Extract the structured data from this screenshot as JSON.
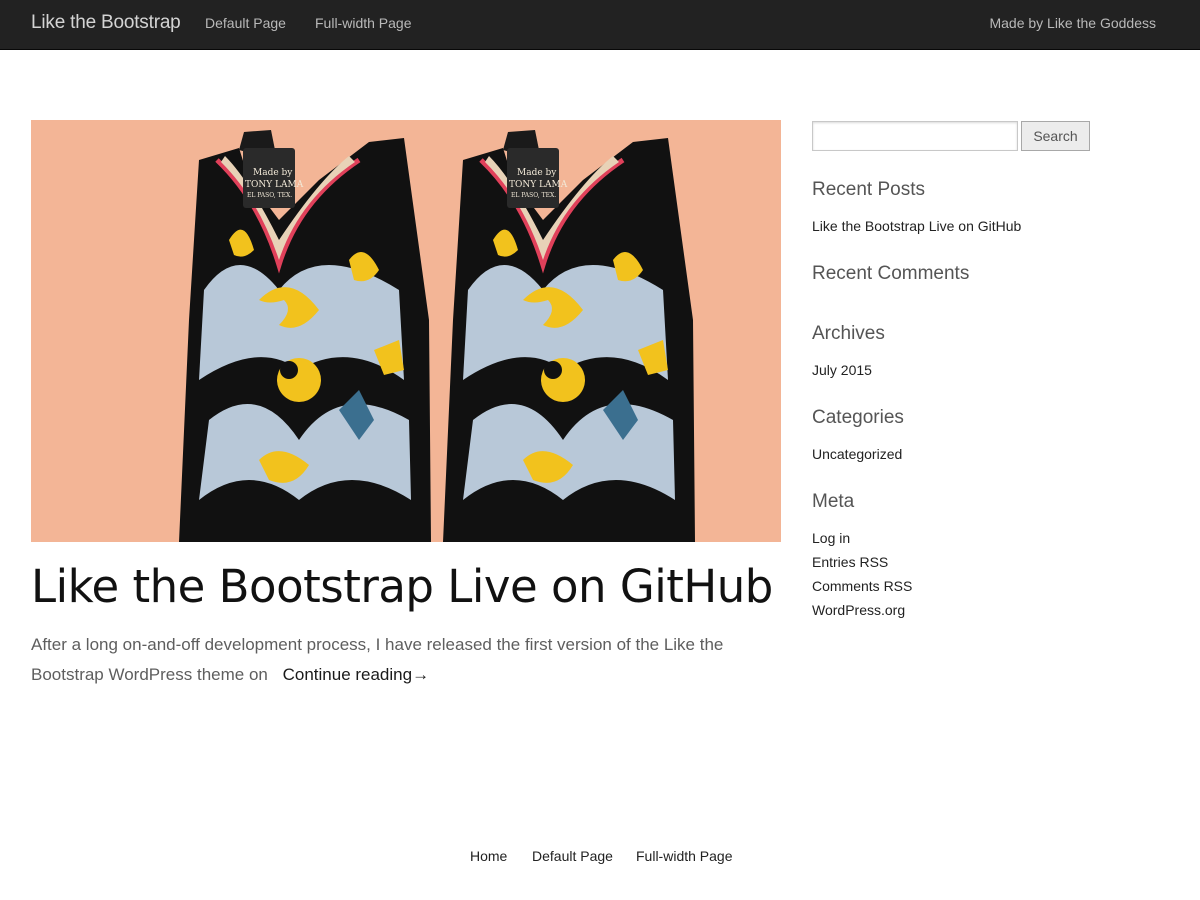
{
  "navbar": {
    "brand": "Like the Bootstrap",
    "links": [
      "Default Page",
      "Full-width Page"
    ],
    "right_link": "Made by Like the Goddess",
    "background": "#222222"
  },
  "post": {
    "image_alt": "Pair of decorated cowboy boots",
    "boot_label": [
      "Made by",
      "TONY LAMA",
      "EL PASO, TEX."
    ],
    "title": "Like the Bootstrap Live on GitHub",
    "excerpt": "After a long on-and-off development process, I have released the first version of the Like the Bootstrap WordPress theme on",
    "continue_label": "Continue reading→"
  },
  "sidebar": {
    "search": {
      "value": "",
      "button_label": "Search"
    },
    "recent_posts": {
      "title": "Recent Posts",
      "items": [
        "Like the Bootstrap Live on GitHub"
      ]
    },
    "recent_comments": {
      "title": "Recent Comments"
    },
    "archives": {
      "title": "Archives",
      "items": [
        "July 2015"
      ]
    },
    "categories": {
      "title": "Categories",
      "items": [
        "Uncategorized"
      ]
    },
    "meta": {
      "title": "Meta",
      "items": [
        "Log in",
        "Entries RSS",
        "Comments RSS",
        "WordPress.org"
      ]
    }
  },
  "footer": {
    "links": [
      "Home",
      "Default Page",
      "Full-width Page"
    ]
  }
}
